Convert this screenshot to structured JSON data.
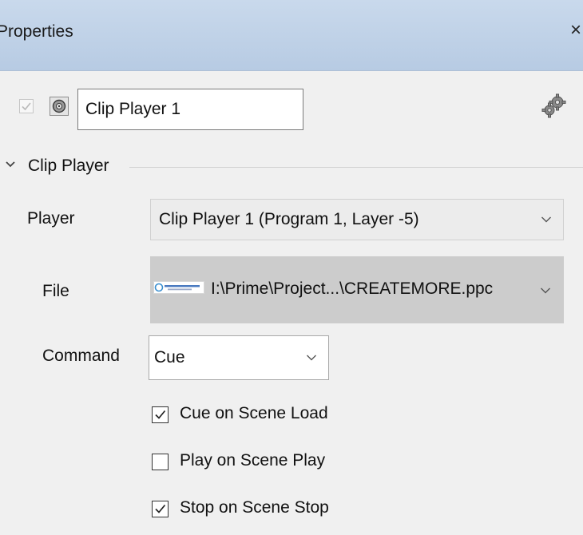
{
  "window": {
    "title": "Properties",
    "close_glyph": "×"
  },
  "object": {
    "enabled": true,
    "name": "Clip Player 1",
    "type_icon": "clip-player-icon",
    "settings_icon": "gears-icon"
  },
  "section": {
    "title": "Clip Player",
    "expanded": true
  },
  "fields": {
    "player": {
      "label": "Player",
      "value": "Clip Player 1 (Program 1, Layer -5)"
    },
    "file": {
      "label": "File",
      "value": "I:\\Prime\\Project...\\CREATEMORE.ppc",
      "thumb_icon": "createmore-logo-thumbnail"
    },
    "command": {
      "label": "Command",
      "value": "Cue"
    }
  },
  "options": [
    {
      "label": "Cue on Scene Load",
      "checked": true
    },
    {
      "label": "Play on Scene Play",
      "checked": false
    },
    {
      "label": "Stop on Scene Stop",
      "checked": true
    }
  ],
  "colors": {
    "titlebar": "#c4d6ea",
    "panel": "#f0f0f0",
    "file_field": "#cccccc",
    "player_field": "#ececec"
  }
}
